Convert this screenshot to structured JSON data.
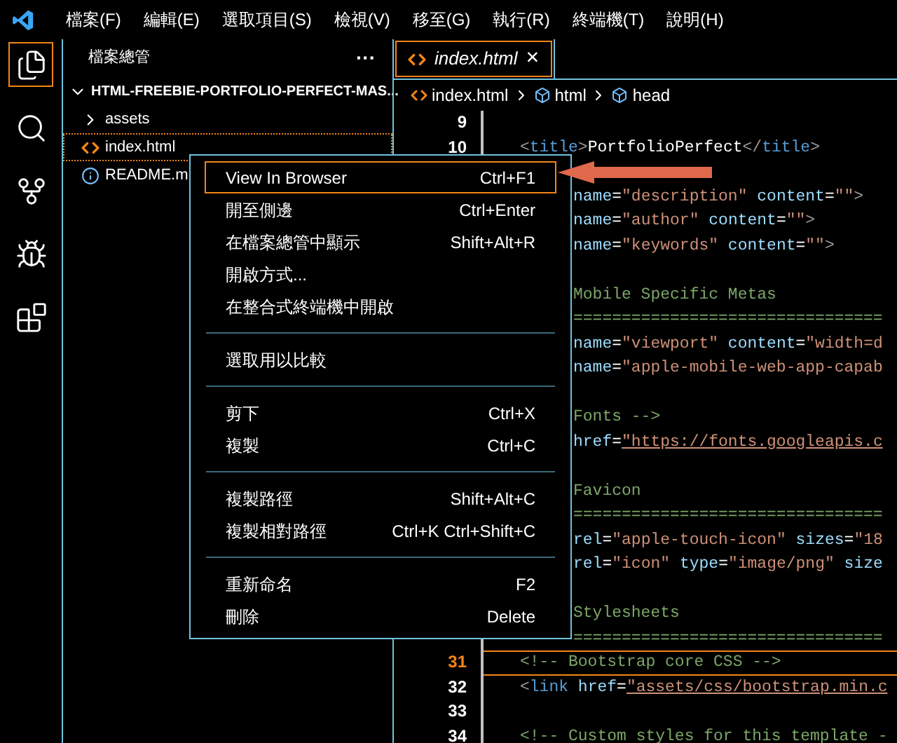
{
  "menu_bar": [
    "檔案(F)",
    "編輯(E)",
    "選取項目(S)",
    "檢視(V)",
    "移至(G)",
    "執行(R)",
    "終端機(T)",
    "說明(H)"
  ],
  "activity_bar": [
    {
      "kind": "explorer",
      "selected": true
    },
    {
      "kind": "search",
      "selected": false
    },
    {
      "kind": "source-control",
      "selected": false
    },
    {
      "kind": "run-debug",
      "selected": false
    },
    {
      "kind": "extensions",
      "selected": false
    }
  ],
  "sidebar": {
    "title": "檔案總管",
    "more": "···",
    "folder": {
      "name": "HTML-FREEBIE-PORTFOLIO-PERFECT-MAS...",
      "expanded": true,
      "children": [
        {
          "name": "assets",
          "kind": "folder",
          "selected": false
        },
        {
          "name": "index.html",
          "kind": "html",
          "selected": true
        },
        {
          "name": "README.m",
          "kind": "info",
          "selected": false
        }
      ]
    }
  },
  "tabs": [
    {
      "label": "index.html",
      "selected": true,
      "close": "×"
    }
  ],
  "breadcrumb": [
    {
      "label": "index.html",
      "kind": "html"
    },
    {
      "label": "html",
      "kind": "element"
    },
    {
      "label": "head",
      "kind": "element"
    }
  ],
  "code_lines": [
    {
      "number": "9",
      "current": false
    },
    {
      "number": "10",
      "current": false,
      "covered": false,
      "tokens": [
        {
          "t": "<",
          "kind": "punct"
        },
        {
          "t": "title",
          "kind": "tag"
        },
        {
          "t": ">",
          "kind": "punct"
        },
        {
          "t": "PortfolioPerfect",
          "kind": "text"
        },
        {
          "t": "</",
          "kind": "punct"
        },
        {
          "t": "title",
          "kind": "tag"
        },
        {
          "t": ">",
          "kind": "punct"
        }
      ]
    },
    {
      "current": false
    },
    {
      "current": false,
      "covered": true,
      "tokens": [
        {
          "t": "name",
          "kind": "attr"
        },
        {
          "t": "=",
          "kind": "text"
        },
        {
          "t": "\"description\"",
          "kind": "string"
        },
        {
          "t": " content",
          "kind": "attr"
        },
        {
          "t": "=",
          "kind": "text"
        },
        {
          "t": "\"\"",
          "kind": "string"
        },
        {
          "t": ">",
          "kind": "punct"
        }
      ]
    },
    {
      "current": false,
      "covered": true,
      "tokens": [
        {
          "t": "name",
          "kind": "attr"
        },
        {
          "t": "=",
          "kind": "text"
        },
        {
          "t": "\"author\"",
          "kind": "string"
        },
        {
          "t": " content",
          "kind": "attr"
        },
        {
          "t": "=",
          "kind": "text"
        },
        {
          "t": "\"\"",
          "kind": "string"
        },
        {
          "t": ">",
          "kind": "punct"
        }
      ]
    },
    {
      "current": false,
      "covered": true,
      "tokens": [
        {
          "t": "name",
          "kind": "attr"
        },
        {
          "t": "=",
          "kind": "text"
        },
        {
          "t": "\"keywords\"",
          "kind": "string"
        },
        {
          "t": " content",
          "kind": "attr"
        },
        {
          "t": "=",
          "kind": "text"
        },
        {
          "t": "\"\"",
          "kind": "string"
        },
        {
          "t": ">",
          "kind": "punct"
        }
      ]
    },
    {
      "current": false
    },
    {
      "current": false,
      "covered": true,
      "tokens": [
        {
          "t": "Mobile Specific Metas",
          "kind": "comment"
        }
      ]
    },
    {
      "current": false,
      "covered": true,
      "tokens": [
        {
          "t": "================================",
          "kind": "comment"
        }
      ]
    },
    {
      "current": false,
      "covered": true,
      "tokens": [
        {
          "t": "name",
          "kind": "attr"
        },
        {
          "t": "=",
          "kind": "text"
        },
        {
          "t": "\"viewport\"",
          "kind": "string"
        },
        {
          "t": " content",
          "kind": "attr"
        },
        {
          "t": "=",
          "kind": "text"
        },
        {
          "t": "\"width=d",
          "kind": "string"
        }
      ]
    },
    {
      "current": false,
      "covered": true,
      "tokens": [
        {
          "t": "name",
          "kind": "attr"
        },
        {
          "t": "=",
          "kind": "text"
        },
        {
          "t": "\"apple-mobile-web-app-capab",
          "kind": "string"
        }
      ]
    },
    {
      "current": false
    },
    {
      "current": false,
      "covered": true,
      "tokens": [
        {
          "t": "Fonts -->",
          "kind": "comment"
        }
      ]
    },
    {
      "current": false,
      "covered": true,
      "tokens": [
        {
          "t": "href",
          "kind": "attr"
        },
        {
          "t": "=",
          "kind": "text"
        },
        {
          "t": "\"https://fonts.googleapis.c",
          "kind": "link"
        }
      ]
    },
    {
      "current": false
    },
    {
      "current": false,
      "covered": true,
      "tokens": [
        {
          "t": "Favicon",
          "kind": "comment"
        }
      ]
    },
    {
      "current": false,
      "covered": true,
      "tokens": [
        {
          "t": "================================",
          "kind": "comment"
        }
      ]
    },
    {
      "current": false,
      "covered": true,
      "tokens": [
        {
          "t": "rel",
          "kind": "attr"
        },
        {
          "t": "=",
          "kind": "text"
        },
        {
          "t": "\"apple-touch-icon\"",
          "kind": "string"
        },
        {
          "t": " sizes",
          "kind": "attr"
        },
        {
          "t": "=",
          "kind": "text"
        },
        {
          "t": "\"18",
          "kind": "string"
        }
      ]
    },
    {
      "current": false,
      "covered": true,
      "tokens": [
        {
          "t": "rel",
          "kind": "attr"
        },
        {
          "t": "=",
          "kind": "text"
        },
        {
          "t": "\"icon\"",
          "kind": "string"
        },
        {
          "t": " type",
          "kind": "attr"
        },
        {
          "t": "=",
          "kind": "text"
        },
        {
          "t": "\"image/png\"",
          "kind": "string"
        },
        {
          "t": " size",
          "kind": "attr"
        }
      ]
    },
    {
      "current": false
    },
    {
      "current": false,
      "covered": true,
      "tokens": [
        {
          "t": "Stylesheets",
          "kind": "comment"
        }
      ]
    },
    {
      "current": false,
      "covered": true,
      "tokens": [
        {
          "t": "================================",
          "kind": "comment"
        }
      ]
    },
    {
      "number": "31",
      "current": true,
      "covered": false,
      "tokens": [
        {
          "t": "<!-- Bootstrap core CSS -->",
          "kind": "comment"
        }
      ]
    },
    {
      "number": "32",
      "current": false,
      "covered": false,
      "tokens": [
        {
          "t": "<",
          "kind": "punct"
        },
        {
          "t": "link",
          "kind": "tag"
        },
        {
          "t": " href",
          "kind": "attr"
        },
        {
          "t": "=",
          "kind": "text"
        },
        {
          "t": "\"assets/css/bootstrap.min.c",
          "kind": "link"
        }
      ]
    },
    {
      "number": "33",
      "current": false
    },
    {
      "number": "34",
      "current": false,
      "covered": false,
      "tokens": [
        {
          "t": "<!-- Custom styles for this template -",
          "kind": "comment"
        }
      ]
    }
  ],
  "context_menu": [
    {
      "kind": "item",
      "label": "View In Browser",
      "shortcut": "Ctrl+F1",
      "selected": true
    },
    {
      "kind": "item",
      "label": "開至側邊",
      "shortcut": "Ctrl+Enter",
      "selected": false
    },
    {
      "kind": "item",
      "label": "在檔案總管中顯示",
      "shortcut": "Shift+Alt+R",
      "selected": false
    },
    {
      "kind": "item",
      "label": "開啟方式...",
      "selected": false
    },
    {
      "kind": "item",
      "label": "在整合式終端機中開啟",
      "selected": false
    },
    {
      "kind": "separator"
    },
    {
      "kind": "item",
      "label": "選取用以比較",
      "selected": false
    },
    {
      "kind": "separator"
    },
    {
      "kind": "item",
      "label": "剪下",
      "shortcut": "Ctrl+X",
      "selected": false
    },
    {
      "kind": "item",
      "label": "複製",
      "shortcut": "Ctrl+C",
      "selected": false
    },
    {
      "kind": "separator"
    },
    {
      "kind": "item",
      "label": "複製路徑",
      "shortcut": "Shift+Alt+C",
      "selected": false
    },
    {
      "kind": "item",
      "label": "複製相對路徑",
      "shortcut": "Ctrl+K Ctrl+Shift+C",
      "selected": false
    },
    {
      "kind": "separator"
    },
    {
      "kind": "item",
      "label": "重新命名",
      "shortcut": "F2",
      "selected": false
    },
    {
      "kind": "item",
      "label": "刪除",
      "shortcut": "Delete",
      "selected": false
    }
  ]
}
